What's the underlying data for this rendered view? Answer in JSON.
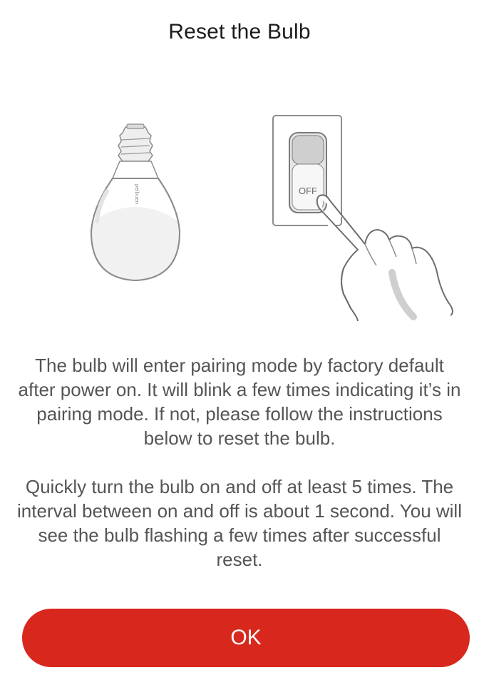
{
  "page": {
    "title": "Reset the Bulb"
  },
  "illustration": {
    "bulb_brand_text": "peibuen",
    "switch_label": "OFF"
  },
  "instructions": {
    "paragraph_1": "The bulb will enter pairing mode by factory default after power on. It will blink a few times indicating it’s in pairing mode. If not, please follow the instructions below to reset the bulb.",
    "paragraph_2": "Quickly turn the bulb on and off at least 5 times. The interval between on and off is about 1 second. You will see the bulb flashing a few times after successful reset."
  },
  "actions": {
    "ok_label": "OK",
    "ok_color": "#d8281e"
  }
}
